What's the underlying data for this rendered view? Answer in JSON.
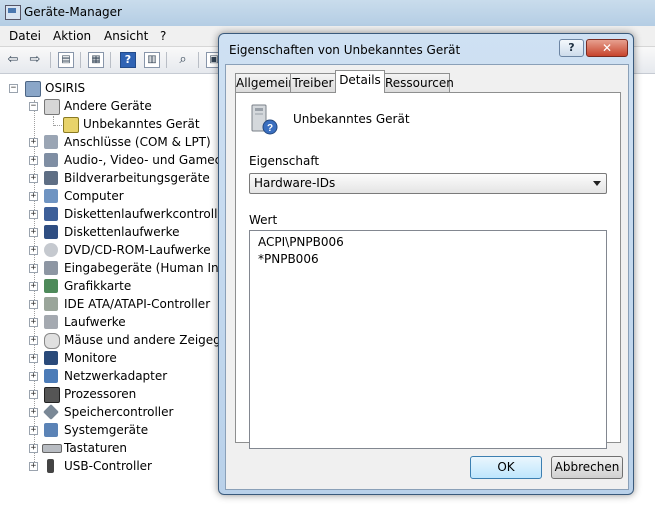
{
  "window": {
    "title": "Geräte-Manager"
  },
  "menu": [
    "Datei",
    "Aktion",
    "Ansicht",
    "?"
  ],
  "toolbar_icons": [
    "back-arrow-icon",
    "forward-arrow-icon",
    "console-tree-icon",
    "properties-icon",
    "help-icon",
    "action-pane-icon",
    "scan-hardware-icon",
    "properties2-icon"
  ],
  "tree": {
    "root": "OSIRIS",
    "items": [
      {
        "label": "Andere Geräte",
        "expanded": true,
        "children": [
          "Unbekanntes Gerät"
        ]
      },
      {
        "label": "Anschlüsse (COM & LPT)"
      },
      {
        "label": "Audio-, Video- und Gamecontroller"
      },
      {
        "label": "Bildverarbeitungsgeräte"
      },
      {
        "label": "Computer"
      },
      {
        "label": "Diskettenlaufwerkcontroller"
      },
      {
        "label": "Diskettenlaufwerke"
      },
      {
        "label": "DVD/CD-ROM-Laufwerke"
      },
      {
        "label": "Eingabegeräte (Human Interface Devices)"
      },
      {
        "label": "Grafikkarte"
      },
      {
        "label": "IDE ATA/ATAPI-Controller"
      },
      {
        "label": "Laufwerke"
      },
      {
        "label": "Mäuse und andere Zeigegeräte"
      },
      {
        "label": "Monitore"
      },
      {
        "label": "Netzwerkadapter"
      },
      {
        "label": "Prozessoren"
      },
      {
        "label": "Speichercontroller"
      },
      {
        "label": "Systemgeräte"
      },
      {
        "label": "Tastaturen"
      },
      {
        "label": "USB-Controller"
      }
    ]
  },
  "dialog": {
    "title": "Eigenschaften von Unbekanntes Gerät",
    "help_label": "?",
    "close_label": "✕",
    "tabs": [
      "Allgemein",
      "Treiber",
      "Details",
      "Ressourcen"
    ],
    "active_tab": "Details",
    "device_name": "Unbekanntes Gerät",
    "property_label": "Eigenschaft",
    "property_value": "Hardware-IDs",
    "value_label": "Wert",
    "values": [
      "ACPI\\PNPB006",
      "*PNPB006"
    ],
    "ok_label": "OK",
    "cancel_label": "Abbrechen"
  }
}
